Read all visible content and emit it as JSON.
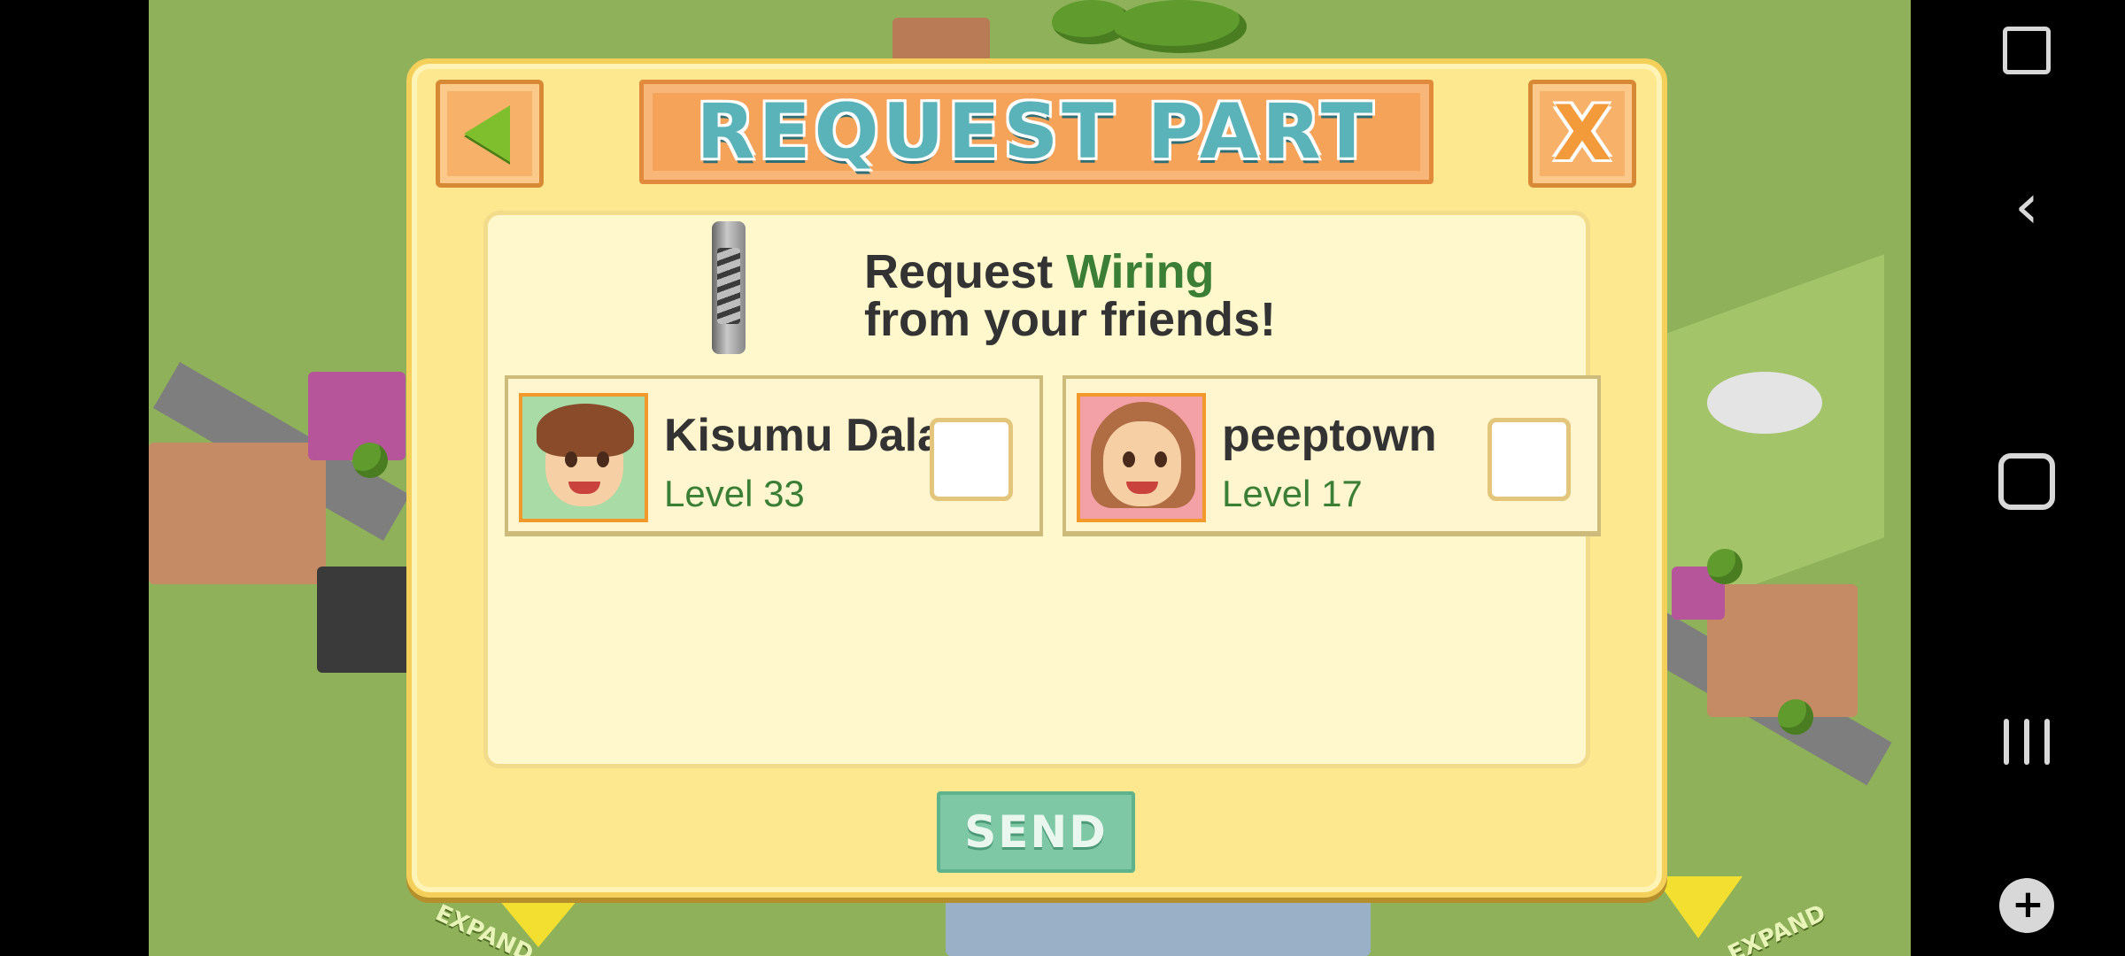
{
  "dialog": {
    "title": "REQUEST PART",
    "back_icon": "back-arrow-icon",
    "close_icon": "close-x-icon",
    "close_label": "X",
    "request_prefix": "Request ",
    "part_name": "Wiring",
    "request_suffix": "from your friends!",
    "send_label": "SEND"
  },
  "friends": [
    {
      "name": "Kisumu Dala",
      "level": "Level 33",
      "avatar": "boy-avatar",
      "checked": false
    },
    {
      "name": "peeptown",
      "level": "Level 17",
      "avatar": "girl-avatar",
      "checked": false
    }
  ],
  "background": {
    "expand_left": "EXPAND",
    "expand_right": "EXPAND"
  },
  "navbar": {
    "icons": [
      "screen-tool-icon",
      "back-icon",
      "home-icon",
      "recents-icon",
      "game-tools-icon"
    ]
  },
  "colors": {
    "title_text": "#5ab3b8",
    "part_name": "#3a7f35",
    "send_button": "#7fc8a6"
  }
}
